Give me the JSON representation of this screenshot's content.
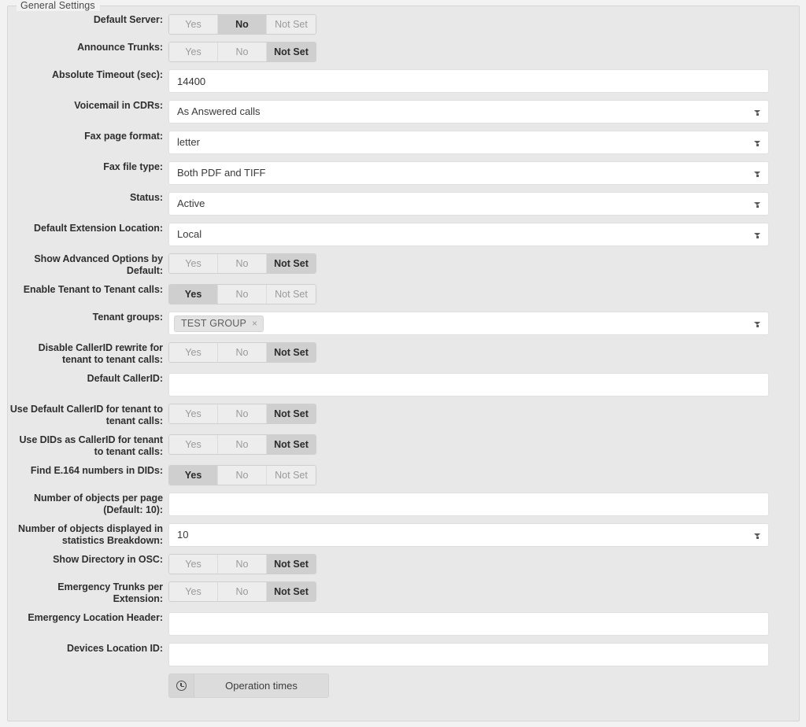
{
  "fieldset": {
    "legend": "General Settings"
  },
  "toggle_options": {
    "yes": "Yes",
    "no": "No",
    "not_set": "Not Set"
  },
  "rows": [
    {
      "label": "Default Server:",
      "type": "segmented",
      "selected": "No"
    },
    {
      "label": "Announce Trunks:",
      "type": "segmented",
      "selected": "Not Set"
    },
    {
      "label": "Absolute Timeout (sec):",
      "type": "text",
      "value": "14400"
    },
    {
      "label": "Voicemail in CDRs:",
      "type": "select",
      "value": "As Answered calls"
    },
    {
      "label": "Fax page format:",
      "type": "select",
      "value": "letter"
    },
    {
      "label": "Fax file type:",
      "type": "select",
      "value": "Both PDF and TIFF"
    },
    {
      "label": "Status:",
      "type": "select",
      "value": "Active"
    },
    {
      "label": "Default Extension Location:",
      "type": "select",
      "value": "Local"
    },
    {
      "label": "Show Advanced Options by Default:",
      "type": "segmented",
      "selected": "Not Set"
    },
    {
      "label": "Enable Tenant to Tenant calls:",
      "type": "segmented",
      "selected": "Yes"
    },
    {
      "label": "Tenant groups:",
      "type": "tokens",
      "chips": [
        "TEST GROUP"
      ]
    },
    {
      "label": "Disable CallerID rewrite for tenant to tenant calls:",
      "type": "segmented",
      "selected": "Not Set"
    },
    {
      "label": "Default CallerID:",
      "type": "text",
      "value": ""
    },
    {
      "label": "Use Default CallerID for tenant to tenant calls:",
      "type": "segmented",
      "selected": "Not Set"
    },
    {
      "label": "Use DIDs as CallerID for tenant to tenant calls:",
      "type": "segmented",
      "selected": "Not Set"
    },
    {
      "label": "Find E.164 numbers in DIDs:",
      "type": "segmented",
      "selected": "Yes"
    },
    {
      "label": "Number of objects per page (Default: 10):",
      "type": "text",
      "value": ""
    },
    {
      "label": "Number of objects displayed in statistics Breakdown:",
      "type": "select",
      "value": "10"
    },
    {
      "label": "Show Directory in OSC:",
      "type": "segmented",
      "selected": "Not Set"
    },
    {
      "label": "Emergency Trunks per Extension:",
      "type": "segmented",
      "selected": "Not Set"
    },
    {
      "label": "Emergency Location Header:",
      "type": "text",
      "value": ""
    },
    {
      "label": "Devices Location ID:",
      "type": "text",
      "value": ""
    }
  ],
  "operation_times_button": {
    "label": "Operation times",
    "icon": "clock-icon"
  },
  "colors": {
    "page_background": "#f2f2f2",
    "panel_background": "#e8e8e8",
    "input_background": "#ffffff",
    "segment_inactive": "#ededed",
    "segment_active": "#cfcfcf",
    "chip_background": "#e3e3e3"
  }
}
